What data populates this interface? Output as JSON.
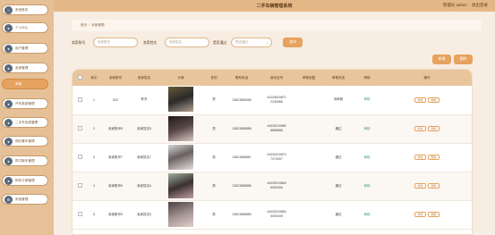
{
  "header": {
    "title": "二手车辆管理系统",
    "user_label": "管理员 admin",
    "logout": "退出登录"
  },
  "sidebar": {
    "items": [
      {
        "label": "系统首页"
      },
      {
        "label": "个人中心"
      },
      {
        "label": "用户管理"
      },
      {
        "label": "卖家管理"
      },
      {
        "label": "审核"
      },
      {
        "label": "汽车类型管理"
      },
      {
        "label": "二手车信息管理"
      },
      {
        "label": "预约看车管理"
      },
      {
        "label": "预订取车管理"
      },
      {
        "label": "购车订单管理"
      },
      {
        "label": "系统管理"
      }
    ]
  },
  "breadcrumb": {
    "home": "首页",
    "current": "卖家管理"
  },
  "filters": {
    "account_label": "卖家账号",
    "account_placeholder": "卖家账号",
    "name_label": "卖家姓名",
    "name_placeholder": "卖家姓名",
    "review_label": "是否通过",
    "review_placeholder": "是否通过",
    "search_button": "查询"
  },
  "actions": {
    "add": "新增",
    "delete": "删除"
  },
  "table": {
    "columns": [
      "",
      "索引",
      "卖家账号",
      "卖家姓名",
      "头像",
      "性别",
      "联系电话",
      "身份证号",
      "审核回复",
      "审核状态",
      "审核",
      "操作"
    ],
    "rows": [
      {
        "index": "1",
        "account": "002",
        "name": "陈杰",
        "gender": "男",
        "phone": "13823889956",
        "id_1": "44143619871",
        "id_2": "2230985",
        "reply": "",
        "status": "待审核",
        "review": "审核",
        "photo": "ph1"
      },
      {
        "index": "2",
        "account": "卖家账号8",
        "name": "卖家姓名8",
        "gender": "男",
        "phone": "13823888888",
        "id_1": "44030019880",
        "id_2": "8888888",
        "reply": "",
        "status": "通过",
        "review": "审核",
        "photo": "ph2"
      },
      {
        "index": "3",
        "account": "卖家账号7",
        "name": "卖家姓名7",
        "gender": "男",
        "phone": "13823888887",
        "id_1": "44030019870",
        "id_2": "7070007",
        "reply": "",
        "status": "通过",
        "review": "审核",
        "photo": "ph3"
      },
      {
        "index": "4",
        "account": "卖家账号6",
        "name": "卖家姓名6",
        "gender": "男",
        "phone": "13823888886",
        "id_1": "44030019860",
        "id_2": "6060006",
        "reply": "",
        "status": "通过",
        "review": "审核",
        "photo": "ph4"
      },
      {
        "index": "5",
        "account": "卖家账号5",
        "name": "卖家姓名5",
        "gender": "男",
        "phone": "13823888885",
        "id_1": "44030019850",
        "id_2": "5050005",
        "reply": "",
        "status": "通过",
        "review": "审核",
        "photo": "ph5"
      }
    ],
    "op_edit": "修改",
    "op_delete": "删除"
  },
  "colors": {
    "accent": "#e6a25e",
    "header_bg": "#e4b886",
    "sidebar_bg": "#e6c197"
  }
}
